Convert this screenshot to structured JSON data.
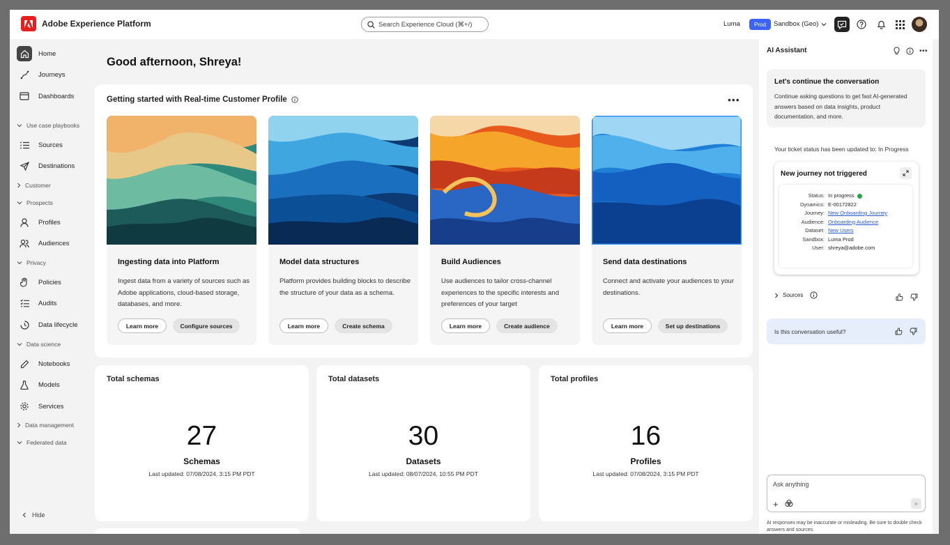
{
  "header": {
    "app_title": "Adobe Experience Platform",
    "search_placeholder": "Search Experience Cloud (⌘+/)",
    "org": "Luma",
    "env_badge": "Prod",
    "sandbox": "Sandbox (Geo)"
  },
  "sidebar": {
    "home": "Home",
    "journeys": "Journeys",
    "dashboards": "Dashboards",
    "sec_playbooks": "Use case playbooks",
    "sources": "Sources",
    "destinations": "Destinations",
    "sec_customer": "Customer",
    "sec_prospects": "Prospects",
    "profiles": "Profiles",
    "audiences": "Audiences",
    "sec_privacy": "Privacy",
    "policies": "Policies",
    "audits": "Audits",
    "data_lifecycle": "Data lifecycle",
    "sec_data_science": "Data science",
    "notebooks": "Notebooks",
    "models": "Models",
    "services": "Services",
    "sec_data_management": "Data management",
    "sec_federated": "Federated data",
    "hide": "Hide"
  },
  "main": {
    "greeting": "Good afternoon, Shreya!",
    "getting_started": {
      "title": "Getting started with Real-time Customer Profile",
      "tiles": [
        {
          "title": "Ingesting data into Platform",
          "desc": "Ingest data from a variety of sources such as Adobe applications, cloud-based storage, databases, and more.",
          "btn1": "Learn more",
          "btn2": "Configure sources"
        },
        {
          "title": "Model data structures",
          "desc": "Platform provides building blocks to describe the structure of your data as a schema.",
          "btn1": "Learn more",
          "btn2": "Create schema"
        },
        {
          "title": "Build Audiences",
          "desc": "Use audiences to tailor cross-channel experiences to the specific interests and preferences of your target",
          "btn1": "Learn more",
          "btn2": "Create audience"
        },
        {
          "title": "Send data destinations",
          "desc": "Connect and activate your audiences to your destinations.",
          "btn1": "Learn more",
          "btn2": "Set up destinations"
        }
      ]
    },
    "stats": [
      {
        "title": "Total schemas",
        "value": "27",
        "label": "Schemas",
        "updated": "Last updated: 07/08/2024, 3:15 PM PDT"
      },
      {
        "title": "Total datasets",
        "value": "30",
        "label": "Datasets",
        "updated": "Last updated: 08/07/2024, 10:55 PM PDT"
      },
      {
        "title": "Total profiles",
        "value": "16",
        "label": "Profiles",
        "updated": "Last updated: 07/08/2024, 3:15 PM PDT"
      }
    ]
  },
  "assistant": {
    "title": "AI Assistant",
    "intro_heading": "Let's continue the conversation",
    "intro_body": "Continue asking questions to get fast AI-generated answers based on data insights, product documentation, and more.",
    "ticket_status": "Your ticket status has been updated to: In Progress",
    "ticket": {
      "title": "New journey not triggered",
      "status_k": "Status:",
      "status_v": "In progress",
      "dynamics_k": "Dynamics:",
      "dynamics_v": "E-00172822",
      "journey_k": "Journey:",
      "journey_v": "New Onboarding Journey",
      "audience_k": "Audience:",
      "audience_v": "Onboarding Audience",
      "dataset_k": "Dataset:",
      "dataset_v": "New Users",
      "sandbox_k": "Sandbox:",
      "sandbox_v": "Luma Prod",
      "user_k": "User:",
      "user_v": "shreya@adobe.com"
    },
    "sources_label": "Sources",
    "useful_q": "Is this conversation useful?",
    "input_placeholder": "Ask anything",
    "disclaimer": "AI responses may be inaccurate or misleading. Be sure to double check answers and sources."
  }
}
